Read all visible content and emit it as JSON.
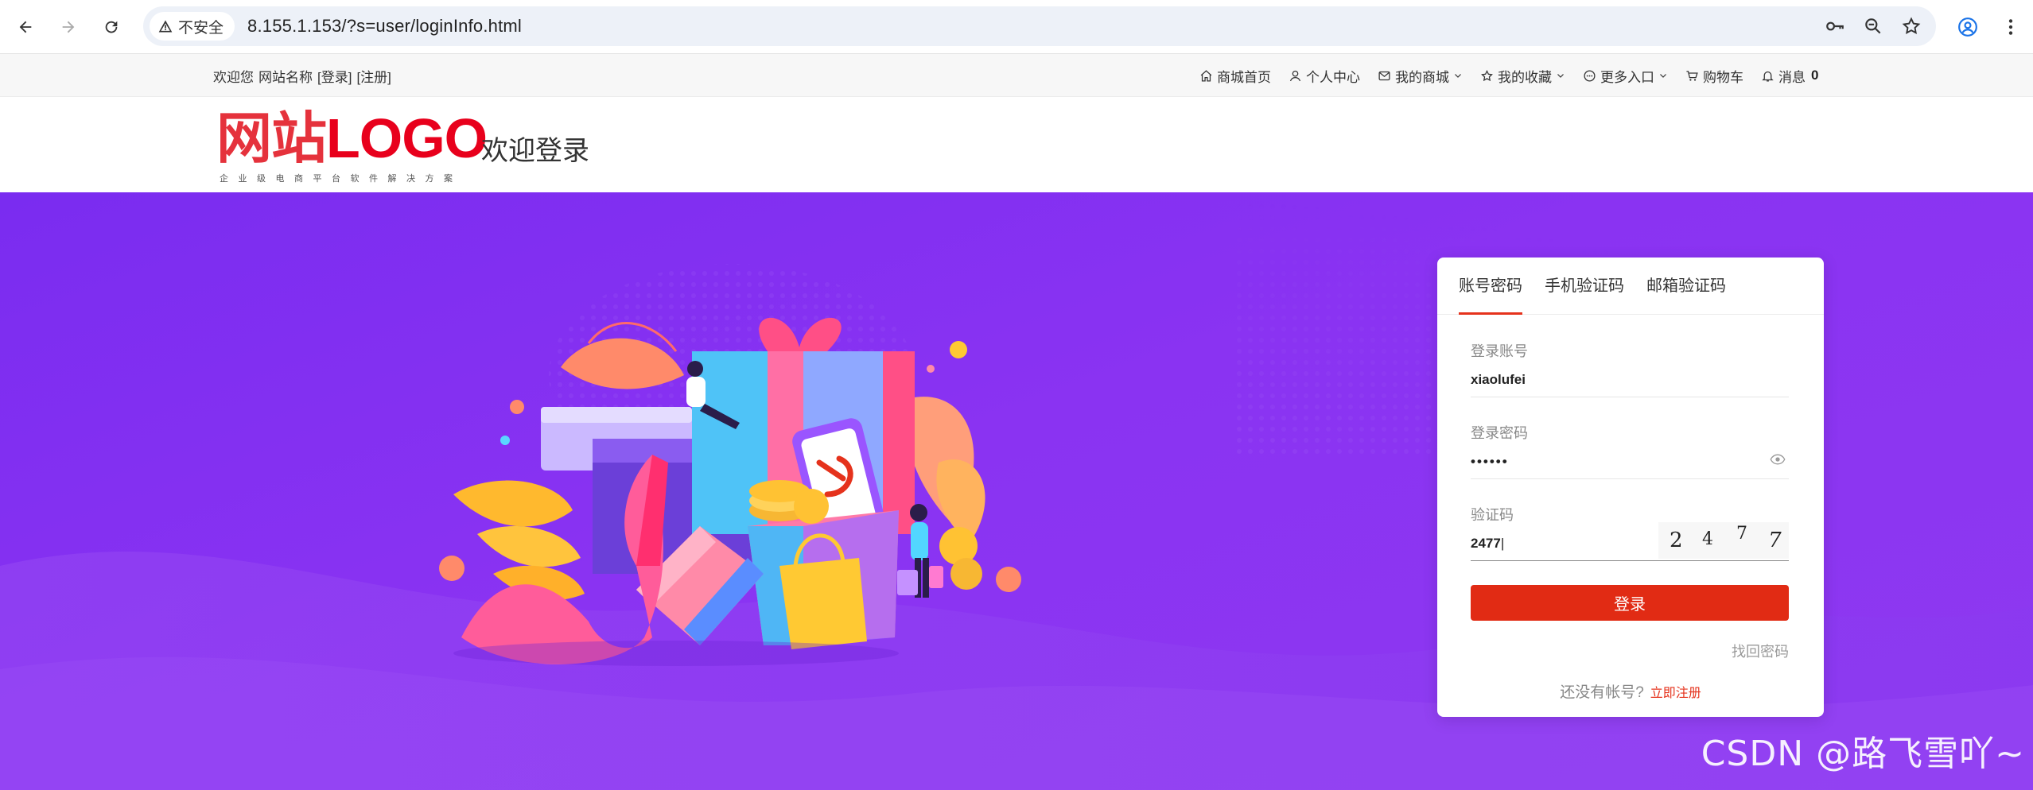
{
  "browser": {
    "security_label": "不安全",
    "url": "8.155.1.153/?s=user/loginInfo.html"
  },
  "topbar": {
    "welcome": "欢迎您",
    "site_name": "网站名称",
    "login_link": "[登录]",
    "register_link": "[注册]",
    "items": [
      {
        "label": "商城首页",
        "icon": "home-icon"
      },
      {
        "label": "个人中心",
        "icon": "user-icon"
      },
      {
        "label": "我的商城",
        "icon": "mail-icon",
        "dropdown": true
      },
      {
        "label": "我的收藏",
        "icon": "star-icon",
        "dropdown": true
      },
      {
        "label": "更多入口",
        "icon": "more-icon",
        "dropdown": true
      },
      {
        "label": "购物车",
        "icon": "cart-icon"
      },
      {
        "label": "消息",
        "icon": "bell-icon",
        "count": "0"
      }
    ]
  },
  "header": {
    "logo_cn": "网站",
    "logo_en": "LOGO",
    "logo_sub": "企业级电商平台软件解决方案",
    "title": "欢迎登录"
  },
  "login": {
    "tabs": [
      "账号密码",
      "手机验证码",
      "邮箱验证码"
    ],
    "active_tab": 0,
    "account_label": "登录账号",
    "account_value": "xiaolufei",
    "password_label": "登录密码",
    "password_value": "••••••",
    "captcha_label": "验证码",
    "captcha_value": "2477",
    "captcha_image_text": [
      "2",
      "4",
      "7",
      "7"
    ],
    "submit_label": "登录",
    "forgot_label": "找回密码",
    "no_account_text": "还没有帐号?",
    "register_label": "立即注册"
  },
  "watermark": "CSDN @路飞雪吖~",
  "colors": {
    "brand_red": "#e12b14",
    "banner_purple": "#8431f1"
  }
}
